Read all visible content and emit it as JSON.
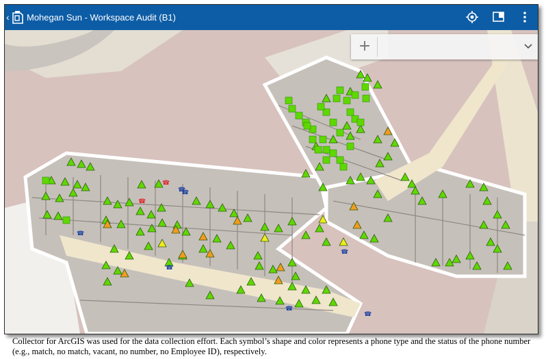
{
  "app": {
    "title": "Mohegan Sun - Workspace Audit (B1)",
    "bar_color": "#0d5da6",
    "icons": [
      "back-chevron-icon",
      "collector-app-icon",
      "gps-location-icon",
      "map-layers-icon",
      "overflow-menu-icon"
    ]
  },
  "search": {
    "add_label": "+"
  },
  "caption": "Collector for ArcGIS was used for the data collection effort. Each symbol’s shape and color represents a phone type and the status of the phone number (e.g., match, no match, vacant, no number, no Employee ID), respectively.",
  "symbol_colors": {
    "green": "#5fd800",
    "orange": "#f59a1f",
    "yellow": "#f2ea1d",
    "red": "#e0252b",
    "blue": "#1a3fa0"
  }
}
